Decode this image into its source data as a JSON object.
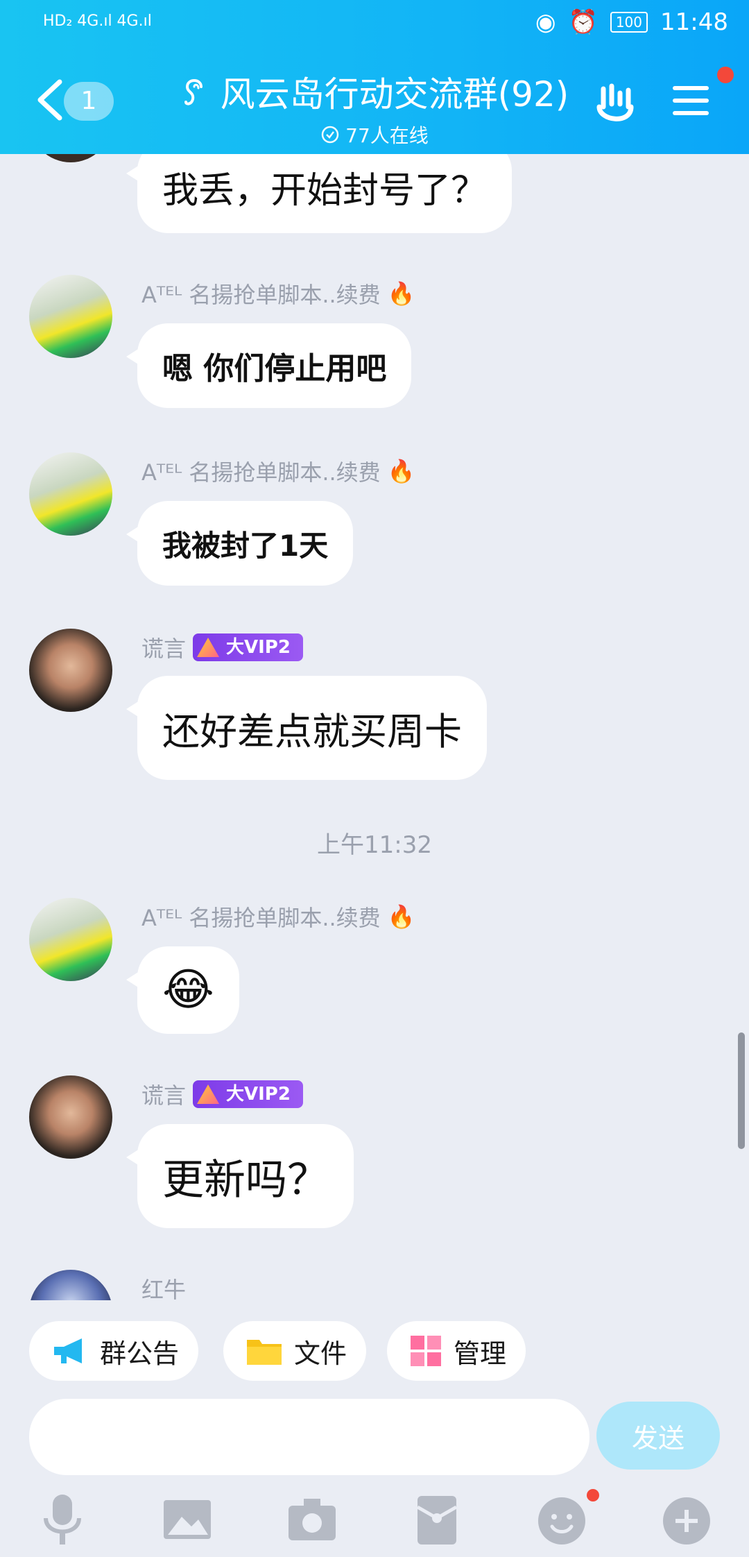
{
  "status_bar": {
    "network_left": "HD₂  4G.ıl  4G.ıl",
    "battery": "100",
    "time": "11:48"
  },
  "header": {
    "unread_count": "1",
    "title": "风云岛行动交流群(92)",
    "online": "77人在线"
  },
  "messages": [
    {
      "nickname": "",
      "text": "我丢，开始封号了？"
    },
    {
      "nickname": "Aᵀᴱᴸ 名揚抢单脚本..续费",
      "text": "嗯  你们停止用吧"
    },
    {
      "nickname": "Aᵀᴱᴸ 名揚抢单脚本..续费",
      "text": "我被封了1天"
    },
    {
      "nickname": "谎言",
      "badge": "大VIP2",
      "text": "还好差点就买周卡"
    },
    {
      "nickname": "Aᵀᴱᴸ 名揚抢单脚本..续费",
      "text": "😂"
    },
    {
      "nickname": "谎言",
      "badge": "大VIP2",
      "text": "更新吗？"
    },
    {
      "nickname": "红牛"
    }
  ],
  "timestamp": "上午11:32",
  "toolbar": {
    "announcement": "群公告",
    "files": "文件",
    "manage": "管理"
  },
  "composer": {
    "placeholder": "",
    "send": "发送"
  },
  "bottom_icons": [
    "microphone-icon",
    "image-icon",
    "camera-icon",
    "red-envelope-icon",
    "emoji-icon",
    "plus-icon"
  ],
  "colors": {
    "header": "#12b4f6",
    "background": "#eaedf4",
    "send_disabled": "#aee7fa",
    "notification": "#f3483a"
  }
}
